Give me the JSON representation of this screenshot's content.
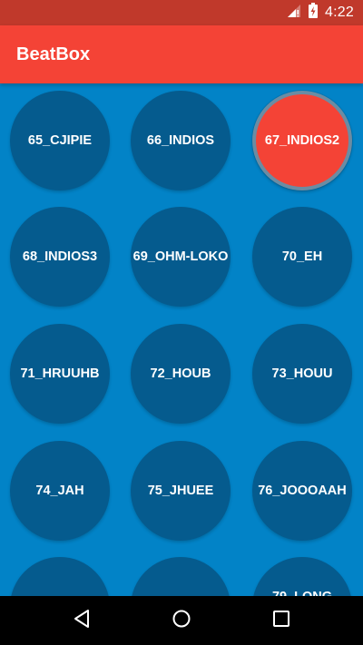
{
  "status_bar": {
    "time": "4:22",
    "icons": [
      "signal-icon",
      "battery-charging-icon"
    ]
  },
  "app_bar": {
    "title": "BeatBox",
    "color": "#f44336"
  },
  "colors": {
    "status_bar": "#c0392b",
    "background": "#0283c7",
    "button": "#055b8e",
    "button_pressed": "#f44336"
  },
  "sounds": [
    {
      "label": "65_CJIPIE"
    },
    {
      "label": "66_INDIOS"
    },
    {
      "label": "67_INDIOS2",
      "pressed": true
    },
    {
      "label": "68_INDIOS3"
    },
    {
      "label": "69_OHM-LOKO"
    },
    {
      "label": "70_EH"
    },
    {
      "label": "71_HRUUHB"
    },
    {
      "label": "72_HOUB"
    },
    {
      "label": "73_HOUU"
    },
    {
      "label": "74_JAH"
    },
    {
      "label": "75_JHUEE"
    },
    {
      "label": "76_JOOOAAH"
    },
    {
      "label": ""
    },
    {
      "label": ""
    },
    {
      "label": "79_LONG"
    }
  ],
  "nav_bar": {
    "icons": [
      "back-icon",
      "home-icon",
      "recents-icon"
    ]
  }
}
